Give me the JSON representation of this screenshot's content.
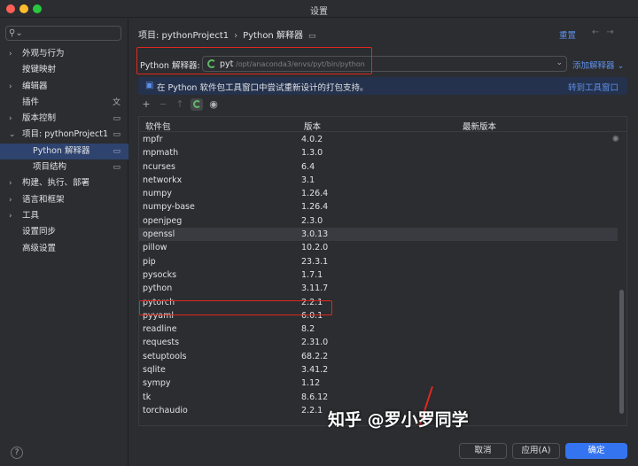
{
  "window": {
    "title": "设置"
  },
  "sidebar": {
    "search_placeholder": "",
    "items": [
      {
        "label": "外观与行为",
        "chevron": "›",
        "child": false
      },
      {
        "label": "按键映射",
        "chevron": "",
        "child": false
      },
      {
        "label": "编辑器",
        "chevron": "›",
        "child": false
      },
      {
        "label": "插件",
        "chevron": "",
        "child": false,
        "side_icon": "translate-icon"
      },
      {
        "label": "版本控制",
        "chevron": "›",
        "child": false,
        "side_icon": "doc-icon"
      },
      {
        "label": "项目: pythonProject1",
        "chevron": "⌄",
        "child": false,
        "side_icon": "doc-icon"
      },
      {
        "label": "Python 解释器",
        "chevron": "",
        "child": true,
        "selected": true,
        "side_icon": "doc-icon"
      },
      {
        "label": "项目结构",
        "chevron": "",
        "child": true,
        "side_icon": "doc-icon"
      },
      {
        "label": "构建、执行、部署",
        "chevron": "›",
        "child": false
      },
      {
        "label": "语言和框架",
        "chevron": "›",
        "child": false
      },
      {
        "label": "工具",
        "chevron": "›",
        "child": false
      },
      {
        "label": "设置同步",
        "chevron": "",
        "child": false
      },
      {
        "label": "高级设置",
        "chevron": "",
        "child": false
      }
    ]
  },
  "header": {
    "breadcrumb_project": "项目: pythonProject1",
    "breadcrumb_page": "Python 解释器",
    "reset_label": "重置"
  },
  "interpreter": {
    "label": "Python 解释器:",
    "name": "pyt",
    "path": "/opt/anaconda3/envs/pyt/bin/python",
    "add_label": "添加解释器 ⌄"
  },
  "banner": {
    "message": "在 Python 软件包工具窗口中尝试重新设计的打包支持。",
    "link": "转到工具窗口"
  },
  "table": {
    "headers": [
      "软件包",
      "版本",
      "最新版本"
    ],
    "rows": [
      [
        "mpfr",
        "4.0.2",
        ""
      ],
      [
        "mpmath",
        "1.3.0",
        ""
      ],
      [
        "ncurses",
        "6.4",
        ""
      ],
      [
        "networkx",
        "3.1",
        ""
      ],
      [
        "numpy",
        "1.26.4",
        ""
      ],
      [
        "numpy-base",
        "1.26.4",
        ""
      ],
      [
        "openjpeg",
        "2.3.0",
        ""
      ],
      [
        "openssl",
        "3.0.13",
        ""
      ],
      [
        "pillow",
        "10.2.0",
        ""
      ],
      [
        "pip",
        "23.3.1",
        ""
      ],
      [
        "pysocks",
        "1.7.1",
        ""
      ],
      [
        "python",
        "3.11.7",
        ""
      ],
      [
        "pytorch",
        "2.2.1",
        ""
      ],
      [
        "pyyaml",
        "6.0.1",
        ""
      ],
      [
        "readline",
        "8.2",
        ""
      ],
      [
        "requests",
        "2.31.0",
        ""
      ],
      [
        "setuptools",
        "68.2.2",
        ""
      ],
      [
        "sqlite",
        "3.41.2",
        ""
      ],
      [
        "sympy",
        "1.12",
        ""
      ],
      [
        "tk",
        "8.6.12",
        ""
      ],
      [
        "torchaudio",
        "2.2.1",
        ""
      ]
    ],
    "highlighted_row": 7
  },
  "footer": {
    "cancel_label": "取消",
    "apply_label": "应用(A)",
    "ok_label": "确定"
  },
  "watermark": "知乎 @罗小罗同学",
  "colors": {
    "accent": "#3574f0",
    "link": "#5d8fe8",
    "annotation_red": "#e0281f",
    "selection": "#2e436e"
  }
}
